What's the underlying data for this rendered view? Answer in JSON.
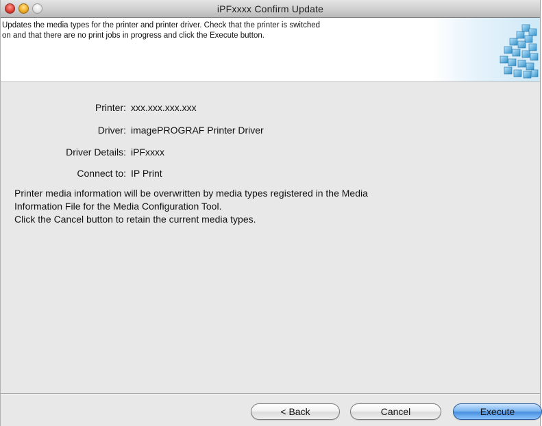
{
  "window": {
    "title": "iPFxxxx  Confirm Update"
  },
  "header": {
    "line1": "Updates the media types for the printer and printer driver. Check that the printer is switched",
    "line2": "on and that there are no print jobs in progress and click the Execute button."
  },
  "info": {
    "printer_label": "Printer:",
    "printer_value": "xxx.xxx.xxx.xxx",
    "driver_label": "Driver:",
    "driver_value": "imagePROGRAF Printer Driver",
    "details_label": "Driver Details:",
    "details_value": "iPFxxxx",
    "connect_label": "Connect to:",
    "connect_value": "IP Print"
  },
  "message": {
    "line1": "Printer media information will be overwritten by media types registered in the Media",
    "line2": "Information File for the Media Configuration Tool.",
    "line3": "Click the Cancel button to retain the current media types."
  },
  "buttons": {
    "back": "< Back",
    "cancel": "Cancel",
    "execute": "Execute"
  },
  "colors": {
    "default_button": "#4a90df",
    "header_accent": "#cfe9f7"
  },
  "icons": {
    "close": "close-icon",
    "minimize": "minimize-icon",
    "zoom": "zoom-icon",
    "banner": "media-cubes-icon"
  }
}
